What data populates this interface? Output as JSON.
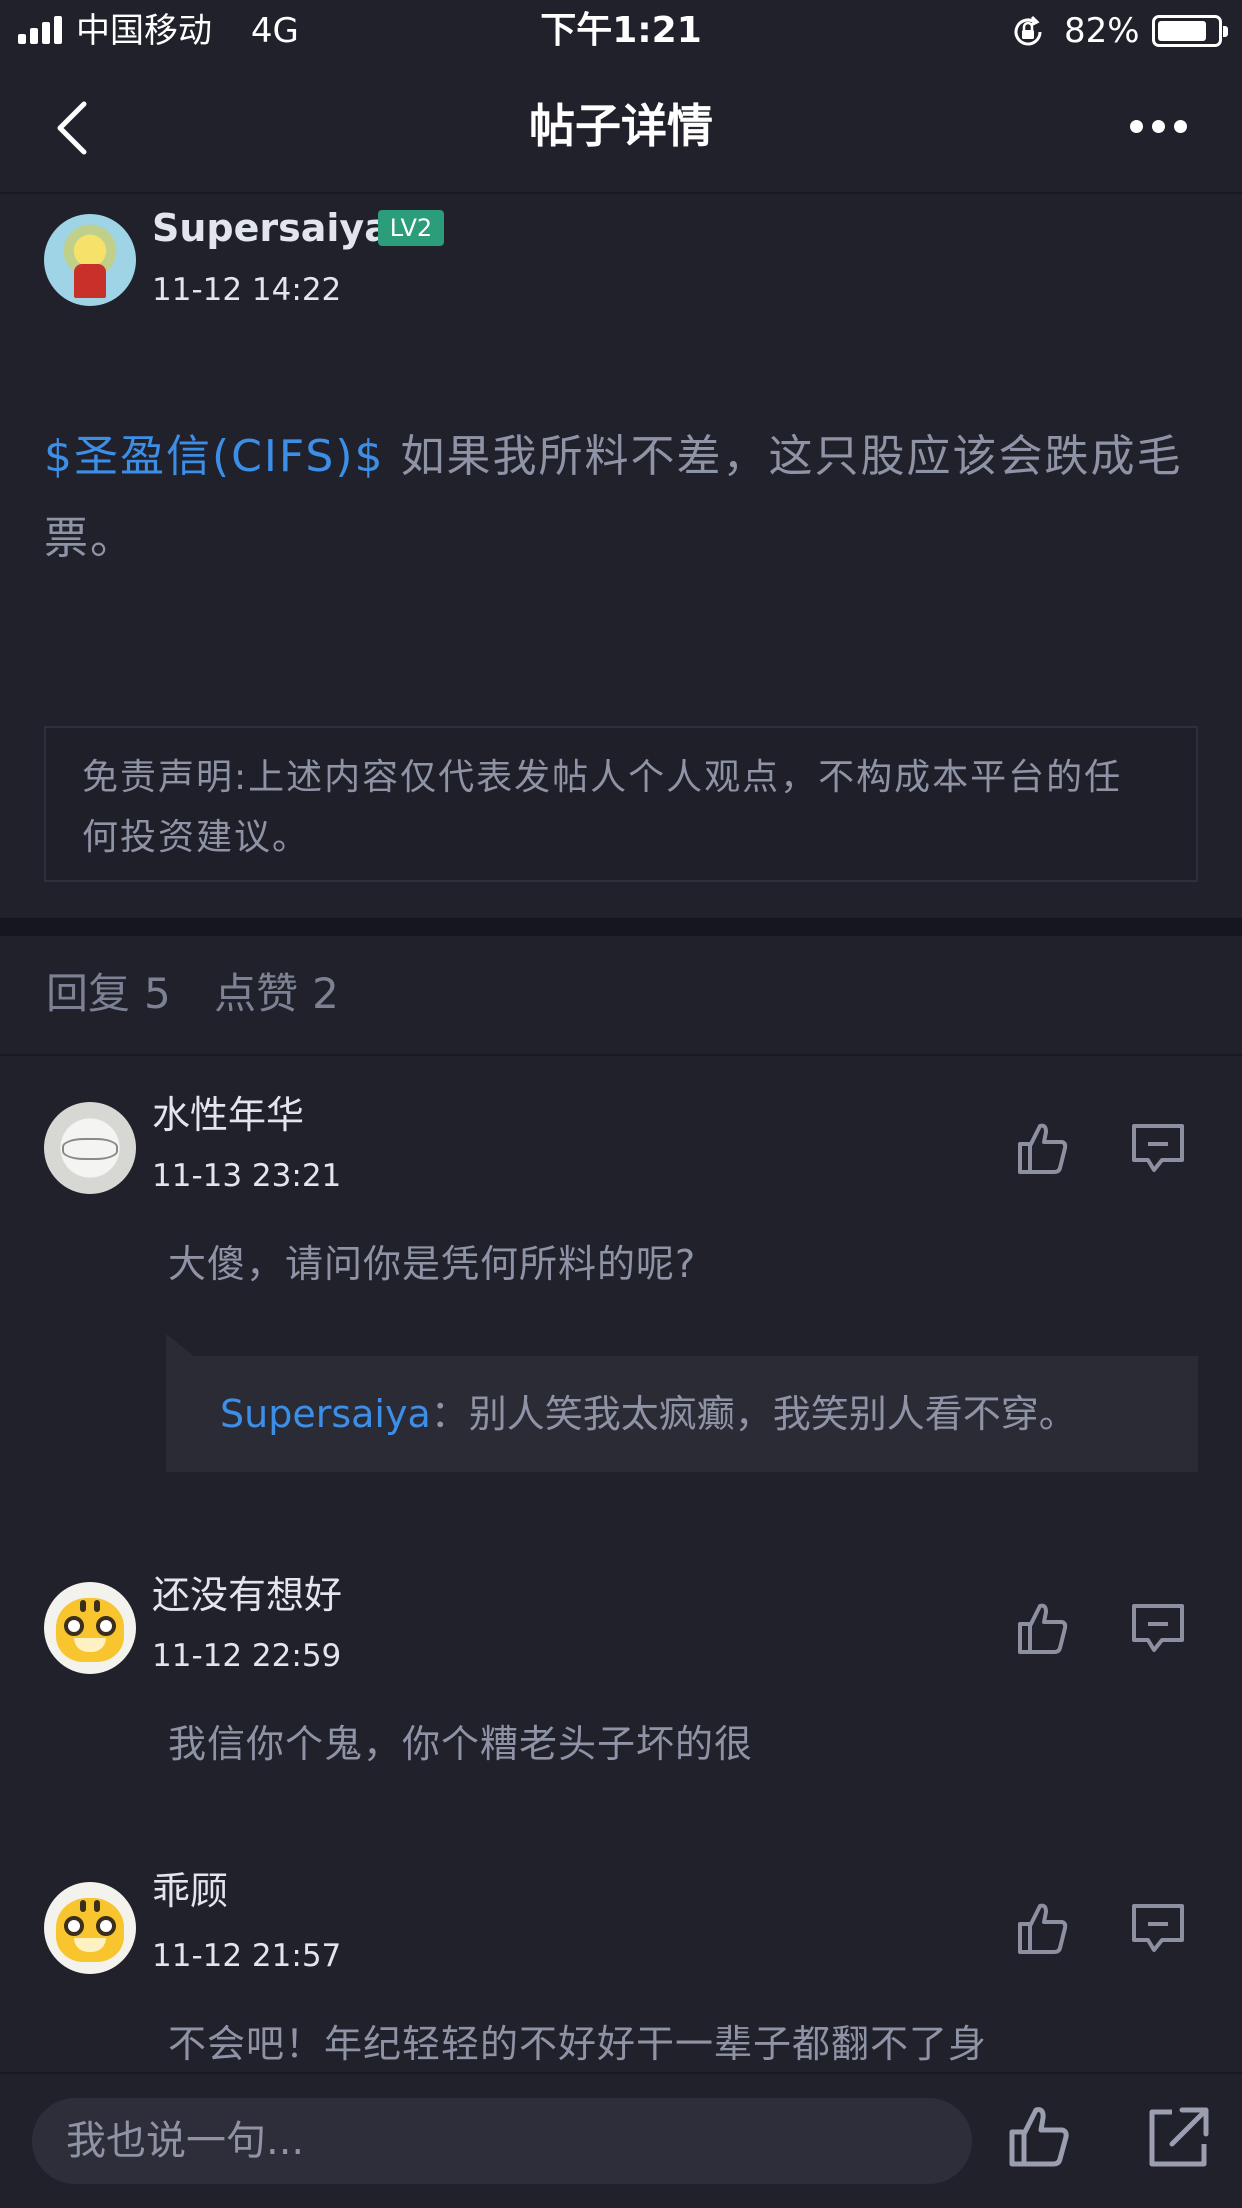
{
  "status_bar": {
    "carrier": "中国移动",
    "network": "4G",
    "time": "下午1:21",
    "battery_percent": "82%",
    "battery_level": 0.82
  },
  "nav": {
    "title": "帖子详情"
  },
  "post": {
    "author": "Supersaiya",
    "level": "LV2",
    "time": "11-12 14:22",
    "stock_tag": "$圣盈信(CIFS)$",
    "content": " 如果我所料不差，这只股应该会跌成毛票。",
    "disclaimer": "免责声明:上述内容仅代表发帖人个人观点，不构成本平台的任何投资建议。"
  },
  "stats": {
    "replies_label": "回复",
    "replies_count": "5",
    "likes_label": "点赞",
    "likes_count": "2"
  },
  "comments": [
    {
      "name": "水性年华",
      "time": "11-13 23:21",
      "text": "大傻，请问你是凭何所料的呢?",
      "reply": {
        "author": "Supersaiya",
        "separator": "：",
        "text": "别人笑我太疯癫，我笑别人看不穿。"
      }
    },
    {
      "name": "还没有想好",
      "time": "11-12 22:59",
      "text": "我信你个鬼，你个糟老头子坏的很"
    },
    {
      "name": "乖顾",
      "time": "11-12 21:57",
      "text": "不会吧！年纪轻轻的不好好干一辈子都翻不了身"
    }
  ],
  "bottom_bar": {
    "input_placeholder": "我也说一句..."
  }
}
